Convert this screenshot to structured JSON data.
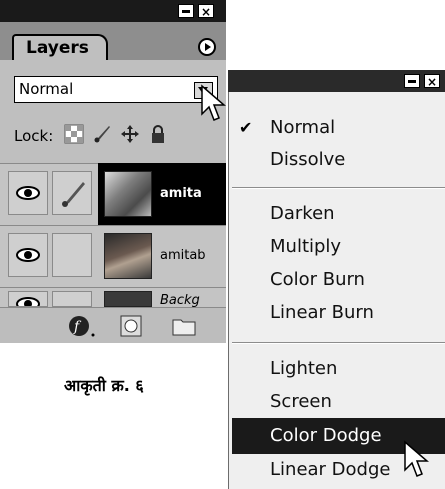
{
  "layers_panel": {
    "tab_label": "Layers",
    "blend_mode_value": "Normal",
    "lock_label": "Lock:",
    "layers": [
      {
        "name": "amita",
        "selected": true
      },
      {
        "name": "amitab",
        "selected": false
      },
      {
        "name": "Backg",
        "selected": false
      }
    ]
  },
  "blend_menu": {
    "items": [
      {
        "label": "Normal",
        "checked": true
      },
      {
        "label": "Dissolve"
      },
      {
        "label": "Darken"
      },
      {
        "label": "Multiply"
      },
      {
        "label": "Color Burn"
      },
      {
        "label": "Linear Burn"
      },
      {
        "label": "Lighten"
      },
      {
        "label": "Screen"
      },
      {
        "label": "Color Dodge",
        "highlighted": true
      },
      {
        "label": "Linear Dodge"
      }
    ],
    "checkmark": "✔"
  },
  "caption": "आकृती क्र. ६",
  "colors": {
    "titlebar": "#1a1a1a",
    "panel": "#bfbfbf",
    "menu_bg": "#efefef",
    "highlight": "#1a1a1a"
  }
}
